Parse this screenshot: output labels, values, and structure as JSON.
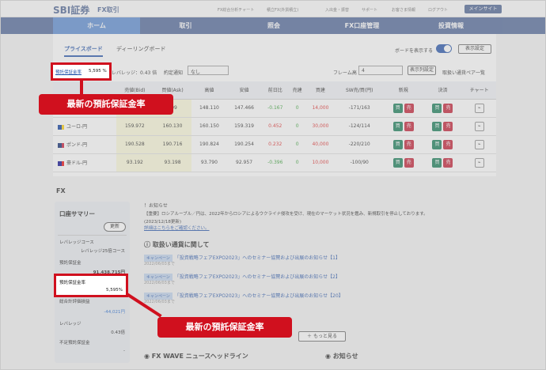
{
  "header": {
    "logo": "SBI証券",
    "logo_sub": "FX取引",
    "links": [
      "FX総合分析チャート",
      "積立FX(外貨積立)",
      "入出金・振替",
      "サポート",
      "お客さま情報",
      "ログアウト"
    ],
    "main_site": "メインサイト"
  },
  "nav": [
    "ホーム",
    "取引",
    "照会",
    "FX口座管理",
    "投資情報"
  ],
  "board": {
    "tabs": [
      "プライスボード",
      "ディーリングボード"
    ],
    "show_board": "ボードを表示する",
    "display_settings": "表示設定",
    "margin_rate_label": "預託保証金率",
    "margin_rate_value": "5,595 %",
    "leverage": "レバレッジ：0.43 倍",
    "order_notice": "約定通知",
    "order_notice_value": "なし",
    "frame": "フレーム高",
    "frame_value": "4",
    "column_settings": "表示列設定",
    "pair_list": "取扱い通貨ペア一覧",
    "columns": [
      "売値(Bid)",
      "買値(Ask)",
      "高値",
      "安値",
      "前日比",
      "売建",
      "買建",
      "SW売/買(円)",
      "新規",
      "決済",
      "チャート"
    ],
    "rows": [
      {
        "pair": "",
        "bid": "",
        "ask": "609",
        "high": "148.110",
        "low": "147.466",
        "chg": "-0.167",
        "sell": "0",
        "buy": "14,000",
        "sw": "-171/163"
      },
      {
        "pair": "ユーロ-円",
        "bid": "159.972",
        "ask": "160.130",
        "high": "160.150",
        "low": "159.319",
        "chg": "0.452",
        "sell": "0",
        "buy": "30,000",
        "sw": "-124/114"
      },
      {
        "pair": "ポンド-円",
        "bid": "190.528",
        "ask": "190.716",
        "high": "190.824",
        "low": "190.254",
        "chg": "0.232",
        "sell": "0",
        "buy": "40,000",
        "sw": "-220/210"
      },
      {
        "pair": "豪ドル-円",
        "bid": "93.192",
        "ask": "93.198",
        "high": "93.790",
        "low": "92.957",
        "chg": "-0.396",
        "sell": "0",
        "buy": "10,000",
        "sw": "-100/90"
      }
    ],
    "buy": "買",
    "sell": "売"
  },
  "fx_title": "FX",
  "summary": {
    "title": "口座サマリー",
    "refresh": "更新",
    "lev_course_label": "レバレッジコース",
    "lev_course_value": "レバレッジ25倍コース",
    "deposit_label": "預託保証金",
    "deposit_value": "91,438,715円",
    "rate_label": "預託保証金率",
    "rate_value": "5,595%",
    "pl_label": "総合計評価損益",
    "pl_value": "-44,021円",
    "lev_label": "レバレッジ",
    "lev_value": "0.43倍",
    "short_label": "不足預託保証金",
    "short_value": "-"
  },
  "news": {
    "notice_title": "！お知らせ",
    "notice_body": "【重要】ロシアルーブル／円は、2022年からロシアによるウクライナ侵攻を受け、現在のマーケット状況を鑑み、新規取引を停止しております。",
    "notice_date": "(2023/12/18更新)",
    "notice_link": "詳細はこちらをご確認ください。",
    "section": "取扱い通貨に関して",
    "badge": "キャンペーン",
    "items": [
      {
        "text": "「投資戦略フェアEXPO2023」へのセミナー協賛および出展のお知らせ【1】",
        "date": "2022/06/03まで"
      },
      {
        "text": "「投資戦略フェアEXPO2023」へのセミナー協賛および出展のお知らせ【2】",
        "date": "2022/06/03まで"
      },
      {
        "text": "「投資戦略フェアEXPO2023」へのセミナー協賛および出展のお知らせ【20】",
        "date": "2022/06/03まで"
      }
    ],
    "more": "もっと見る",
    "fxwave": "FX WAVE ニュースヘッドライン",
    "oshirase": "お知らせ"
  },
  "callouts": {
    "top": "最新の預託保証金率",
    "bottom": "最新の預託保証金率"
  }
}
